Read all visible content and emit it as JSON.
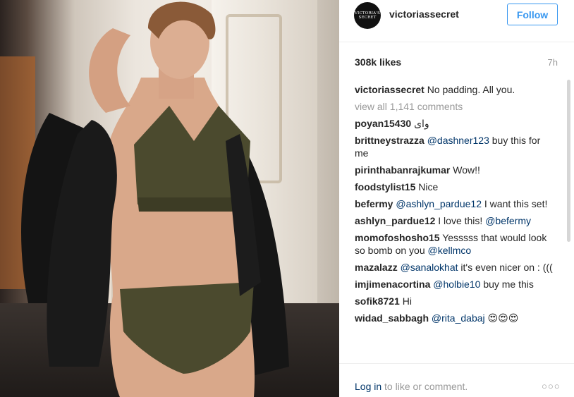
{
  "post": {
    "username": "victoriassecret",
    "avatar_text": "VICTORIA'S SECRET",
    "follow_label": "Follow",
    "likes": "308k likes",
    "time": "7h",
    "caption": {
      "user": "victoriassecret",
      "text": "No padding. All you."
    },
    "view_all": "view all 1,141 comments",
    "comments": [
      {
        "user": "poyan15430",
        "mention": "",
        "text": "وای"
      },
      {
        "user": "brittneystrazza",
        "mention": "@dashner123",
        "text": "buy this for me"
      },
      {
        "user": "pirinthabanrajkumar",
        "mention": "",
        "text": "Wow!!"
      },
      {
        "user": "foodstylist15",
        "mention": "",
        "text": "Nice"
      },
      {
        "user": "befermy",
        "mention": "@ashlyn_pardue12",
        "text": "I want this set!"
      },
      {
        "user": "ashlyn_pardue12",
        "mention": "",
        "text": "I love this!",
        "mention_after": "@befermy"
      },
      {
        "user": "momofoshosho15",
        "mention": "",
        "text": "Yesssss that would look so bomb on you",
        "mention_after": "@kellmco"
      },
      {
        "user": "mazalazz",
        "mention": "@sanalokhat",
        "text": "it's even nicer on : ((("
      },
      {
        "user": "imjimenacortina",
        "mention": "@holbie10",
        "text": "buy me this"
      },
      {
        "user": "sofik8721",
        "mention": "",
        "text": "Hi"
      },
      {
        "user": "widad_sabbagh",
        "mention": "@rita_dabaj",
        "text": "😍😍😍"
      }
    ],
    "footer": {
      "login": "Log in",
      "rest": "to like or comment."
    },
    "more_icon": "ellipsis-icon"
  },
  "colors": {
    "accent": "#3897f0",
    "mention": "#003569",
    "muted": "#999999"
  }
}
